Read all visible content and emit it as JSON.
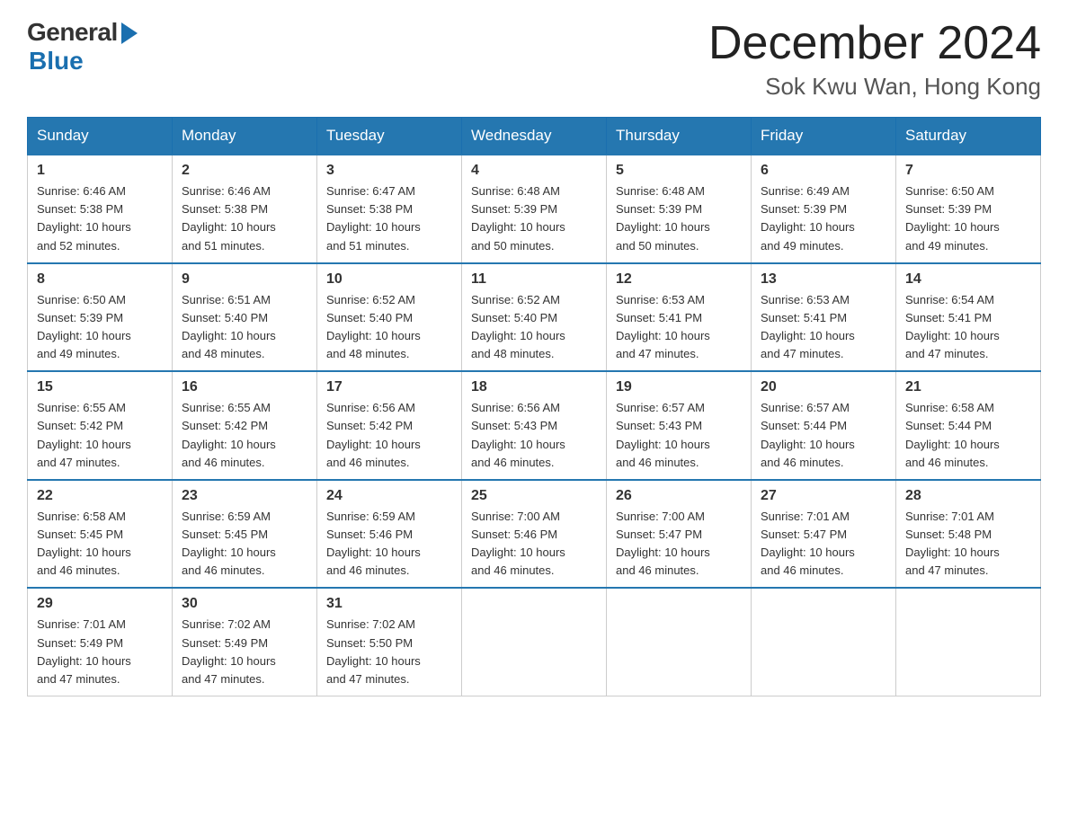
{
  "header": {
    "logo_general": "General",
    "logo_blue": "Blue",
    "month_title": "December 2024",
    "location": "Sok Kwu Wan, Hong Kong"
  },
  "weekdays": [
    "Sunday",
    "Monday",
    "Tuesday",
    "Wednesday",
    "Thursday",
    "Friday",
    "Saturday"
  ],
  "weeks": [
    [
      {
        "day": "1",
        "sunrise": "6:46 AM",
        "sunset": "5:38 PM",
        "daylight": "10 hours and 52 minutes."
      },
      {
        "day": "2",
        "sunrise": "6:46 AM",
        "sunset": "5:38 PM",
        "daylight": "10 hours and 51 minutes."
      },
      {
        "day": "3",
        "sunrise": "6:47 AM",
        "sunset": "5:38 PM",
        "daylight": "10 hours and 51 minutes."
      },
      {
        "day": "4",
        "sunrise": "6:48 AM",
        "sunset": "5:39 PM",
        "daylight": "10 hours and 50 minutes."
      },
      {
        "day": "5",
        "sunrise": "6:48 AM",
        "sunset": "5:39 PM",
        "daylight": "10 hours and 50 minutes."
      },
      {
        "day": "6",
        "sunrise": "6:49 AM",
        "sunset": "5:39 PM",
        "daylight": "10 hours and 49 minutes."
      },
      {
        "day": "7",
        "sunrise": "6:50 AM",
        "sunset": "5:39 PM",
        "daylight": "10 hours and 49 minutes."
      }
    ],
    [
      {
        "day": "8",
        "sunrise": "6:50 AM",
        "sunset": "5:39 PM",
        "daylight": "10 hours and 49 minutes."
      },
      {
        "day": "9",
        "sunrise": "6:51 AM",
        "sunset": "5:40 PM",
        "daylight": "10 hours and 48 minutes."
      },
      {
        "day": "10",
        "sunrise": "6:52 AM",
        "sunset": "5:40 PM",
        "daylight": "10 hours and 48 minutes."
      },
      {
        "day": "11",
        "sunrise": "6:52 AM",
        "sunset": "5:40 PM",
        "daylight": "10 hours and 48 minutes."
      },
      {
        "day": "12",
        "sunrise": "6:53 AM",
        "sunset": "5:41 PM",
        "daylight": "10 hours and 47 minutes."
      },
      {
        "day": "13",
        "sunrise": "6:53 AM",
        "sunset": "5:41 PM",
        "daylight": "10 hours and 47 minutes."
      },
      {
        "day": "14",
        "sunrise": "6:54 AM",
        "sunset": "5:41 PM",
        "daylight": "10 hours and 47 minutes."
      }
    ],
    [
      {
        "day": "15",
        "sunrise": "6:55 AM",
        "sunset": "5:42 PM",
        "daylight": "10 hours and 47 minutes."
      },
      {
        "day": "16",
        "sunrise": "6:55 AM",
        "sunset": "5:42 PM",
        "daylight": "10 hours and 46 minutes."
      },
      {
        "day": "17",
        "sunrise": "6:56 AM",
        "sunset": "5:42 PM",
        "daylight": "10 hours and 46 minutes."
      },
      {
        "day": "18",
        "sunrise": "6:56 AM",
        "sunset": "5:43 PM",
        "daylight": "10 hours and 46 minutes."
      },
      {
        "day": "19",
        "sunrise": "6:57 AM",
        "sunset": "5:43 PM",
        "daylight": "10 hours and 46 minutes."
      },
      {
        "day": "20",
        "sunrise": "6:57 AM",
        "sunset": "5:44 PM",
        "daylight": "10 hours and 46 minutes."
      },
      {
        "day": "21",
        "sunrise": "6:58 AM",
        "sunset": "5:44 PM",
        "daylight": "10 hours and 46 minutes."
      }
    ],
    [
      {
        "day": "22",
        "sunrise": "6:58 AM",
        "sunset": "5:45 PM",
        "daylight": "10 hours and 46 minutes."
      },
      {
        "day": "23",
        "sunrise": "6:59 AM",
        "sunset": "5:45 PM",
        "daylight": "10 hours and 46 minutes."
      },
      {
        "day": "24",
        "sunrise": "6:59 AM",
        "sunset": "5:46 PM",
        "daylight": "10 hours and 46 minutes."
      },
      {
        "day": "25",
        "sunrise": "7:00 AM",
        "sunset": "5:46 PM",
        "daylight": "10 hours and 46 minutes."
      },
      {
        "day": "26",
        "sunrise": "7:00 AM",
        "sunset": "5:47 PM",
        "daylight": "10 hours and 46 minutes."
      },
      {
        "day": "27",
        "sunrise": "7:01 AM",
        "sunset": "5:47 PM",
        "daylight": "10 hours and 46 minutes."
      },
      {
        "day": "28",
        "sunrise": "7:01 AM",
        "sunset": "5:48 PM",
        "daylight": "10 hours and 47 minutes."
      }
    ],
    [
      {
        "day": "29",
        "sunrise": "7:01 AM",
        "sunset": "5:49 PM",
        "daylight": "10 hours and 47 minutes."
      },
      {
        "day": "30",
        "sunrise": "7:02 AM",
        "sunset": "5:49 PM",
        "daylight": "10 hours and 47 minutes."
      },
      {
        "day": "31",
        "sunrise": "7:02 AM",
        "sunset": "5:50 PM",
        "daylight": "10 hours and 47 minutes."
      },
      null,
      null,
      null,
      null
    ]
  ],
  "labels": {
    "sunrise": "Sunrise:",
    "sunset": "Sunset:",
    "daylight": "Daylight:"
  }
}
